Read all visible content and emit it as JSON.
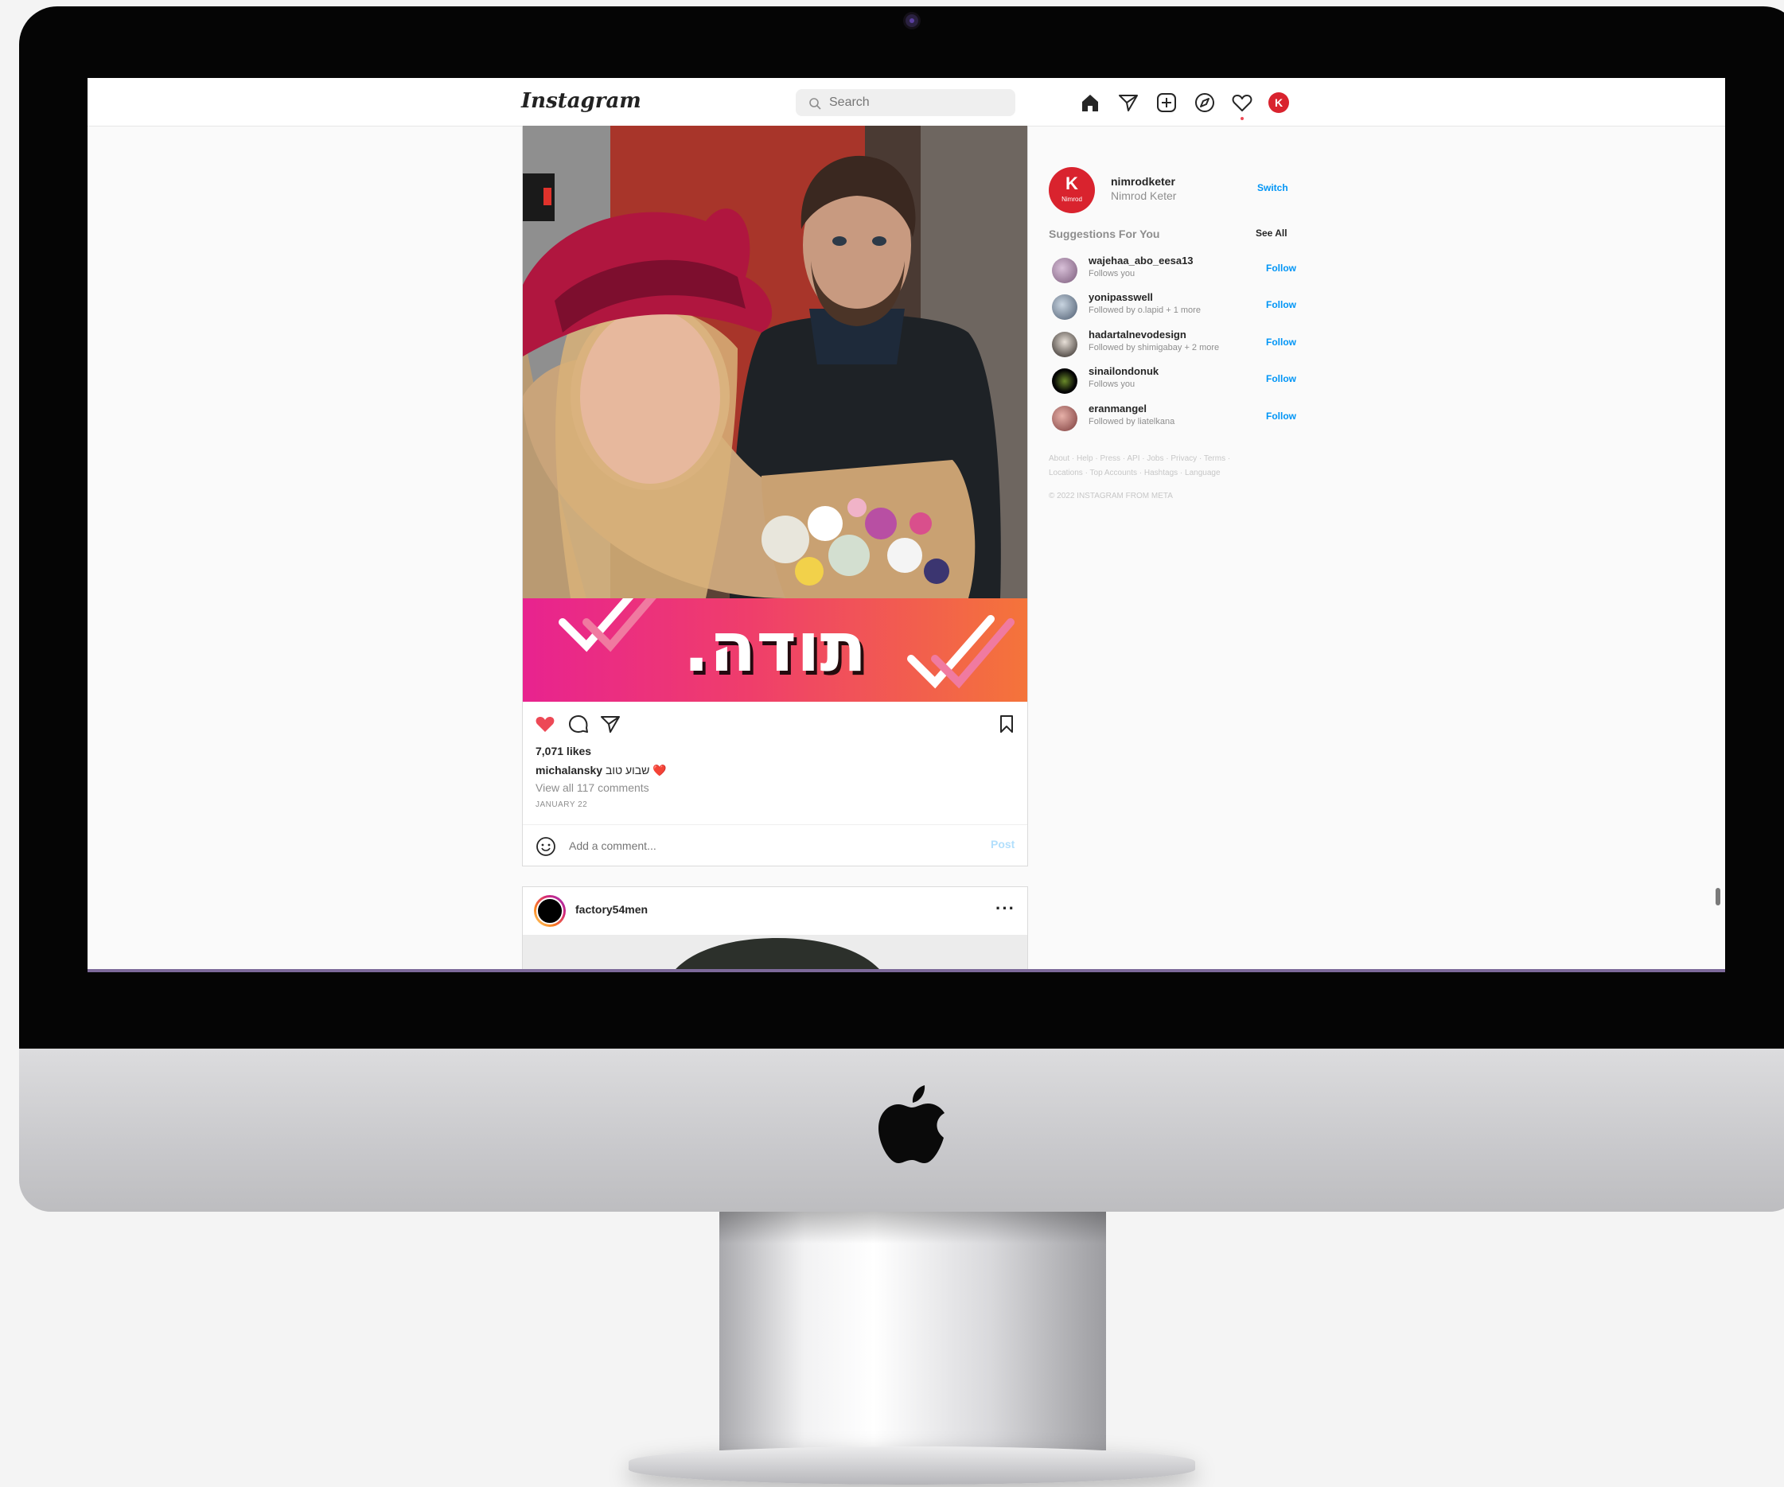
{
  "nav": {
    "logo": "Instagram",
    "search_placeholder": "Search",
    "icons": [
      "home-icon",
      "direct-icon",
      "new-post-icon",
      "explore-icon",
      "activity-icon"
    ],
    "avatar_letter": "K"
  },
  "post": {
    "overlay_text": "תודה.",
    "likes": "7,071 likes",
    "caption_user": "michalansky",
    "caption_text": "שבוע טוב ❤️",
    "view_comments": "View all 117 comments",
    "date": "JANUARY 22",
    "comment_placeholder": "Add a comment...",
    "post_button": "Post",
    "liked": true
  },
  "next_post": {
    "username": "factory54men",
    "more": "···"
  },
  "sidebar": {
    "username": "nimrodketer",
    "full_name": "Nimrod Keter",
    "avatar_letter": "K",
    "avatar_caption": "Nimrod",
    "switch_label": "Switch",
    "suggestions_title": "Suggestions For You",
    "see_all": "See All",
    "suggestions": [
      {
        "username": "wajehaa_abo_eesa13",
        "subtitle": "Follows you",
        "action": "Follow"
      },
      {
        "username": "yonipasswell",
        "subtitle": "Followed by o.lapid + 1 more",
        "action": "Follow"
      },
      {
        "username": "hadartalnevodesign",
        "subtitle": "Followed by shimigabay + 2 more",
        "action": "Follow"
      },
      {
        "username": "sinailondonuk",
        "subtitle": "Follows you",
        "action": "Follow"
      },
      {
        "username": "eranmangel",
        "subtitle": "Followed by liatelkana",
        "action": "Follow"
      }
    ],
    "footer_links_line1": "About · Help · Press · API · Jobs · Privacy · Terms ·",
    "footer_links_line2": "Locations · Top Accounts · Hashtags · Language",
    "copyright": "© 2022 INSTAGRAM FROM META"
  },
  "colors": {
    "accent_blue": "#0095f6",
    "like_red": "#ed4956",
    "banner_start": "#e8238f",
    "banner_end": "#f4743a"
  }
}
